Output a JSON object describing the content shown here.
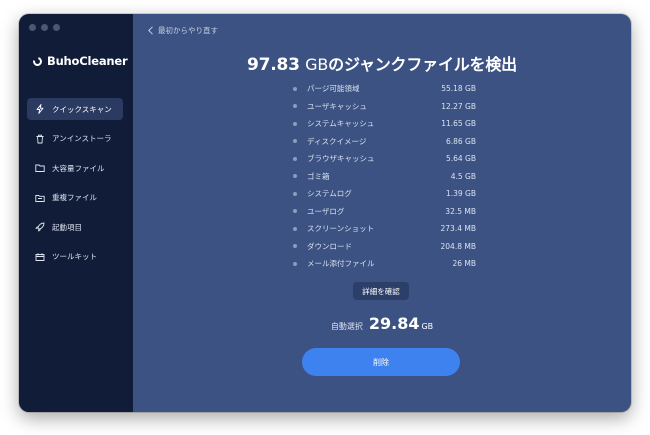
{
  "app": {
    "name": "BuhoCleaner"
  },
  "sidebar": {
    "items": [
      {
        "label": "クイックスキャン",
        "icon": "bolt-icon",
        "active": true
      },
      {
        "label": "アンインストーラ",
        "icon": "trash-icon"
      },
      {
        "label": "大容量ファイル",
        "icon": "folder-icon"
      },
      {
        "label": "重複ファイル",
        "icon": "duplicate-folder-icon"
      },
      {
        "label": "起動項目",
        "icon": "rocket-icon"
      },
      {
        "label": "ツールキット",
        "icon": "toolkit-icon"
      }
    ]
  },
  "header": {
    "back_label": "最初からやり直す"
  },
  "result": {
    "amount": "97.83",
    "unit": "GB",
    "suffix": "のジャンクファイルを検出"
  },
  "junk_items": [
    {
      "label": "パージ可能領域",
      "size": "55.18 GB"
    },
    {
      "label": "ユーザキャッシュ",
      "size": "12.27 GB"
    },
    {
      "label": "システムキャッシュ",
      "size": "11.65 GB"
    },
    {
      "label": "ディスクイメージ",
      "size": "6.86 GB"
    },
    {
      "label": "ブラウザキャッシュ",
      "size": "5.64 GB"
    },
    {
      "label": "ゴミ箱",
      "size": "4.5 GB"
    },
    {
      "label": "システムログ",
      "size": "1.39 GB"
    },
    {
      "label": "ユーザログ",
      "size": "32.5 MB"
    },
    {
      "label": "スクリーンショット",
      "size": "273.4 MB"
    },
    {
      "label": "ダウンロード",
      "size": "204.8 MB"
    },
    {
      "label": "メール添付ファイル",
      "size": "26 MB"
    }
  ],
  "details_button": "詳細を確認",
  "auto_select": {
    "label": "自動選択",
    "amount": "29.84",
    "unit": "GB"
  },
  "delete_button": "削除",
  "colors": {
    "accent": "#3e82f0",
    "sidebar": "#111c38",
    "main": "#3b5282"
  }
}
